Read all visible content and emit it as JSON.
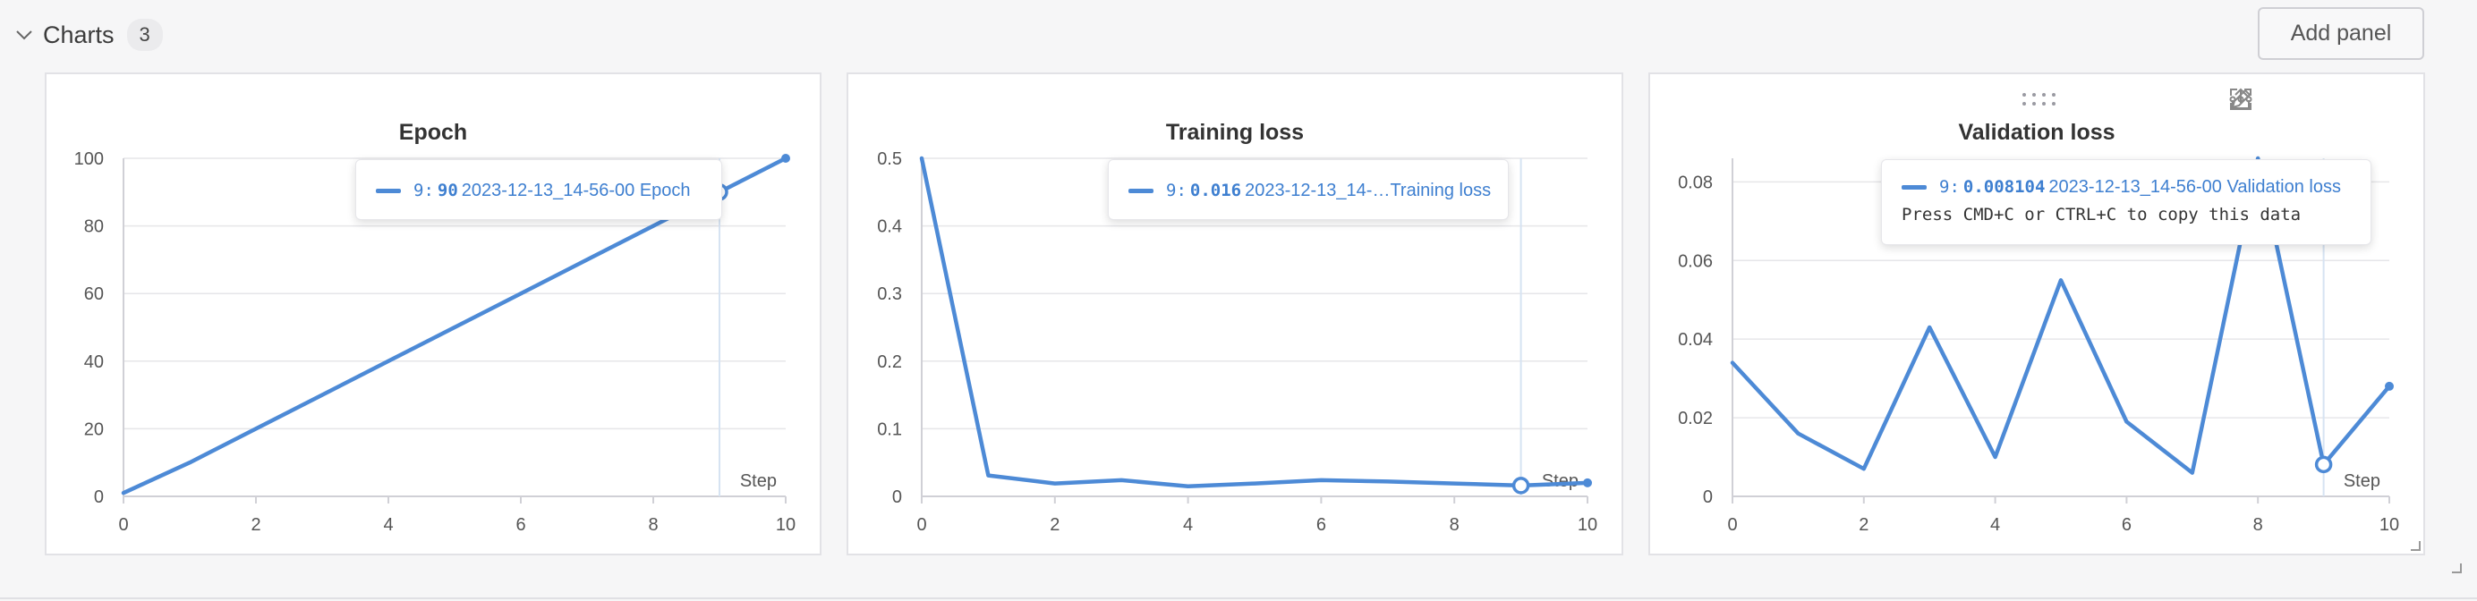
{
  "section": {
    "title": "Charts",
    "count": "3"
  },
  "toolbar": {
    "add_panel_label": "Add panel"
  },
  "colors": {
    "series": "#4d8ad6",
    "grid": "#e6e6e9",
    "axis": "#d0d0d6",
    "text": "#555555",
    "title": "#333333",
    "crosshair": "#d6e3f2"
  },
  "icons": [
    "chevron-down-icon",
    "drag-handle-icon",
    "share-icon",
    "edit-icon",
    "fullscreen-icon",
    "more-icon",
    "resize-icon"
  ],
  "tooltip_copy_hint": "Press CMD+C or CTRL+C to copy this data",
  "chart_data": [
    {
      "type": "line",
      "title": "Epoch",
      "xlabel": "Step",
      "ylabel": "",
      "xlim": [
        0,
        10
      ],
      "ylim": [
        0,
        100
      ],
      "xticks": [
        0,
        2,
        4,
        6,
        8,
        10
      ],
      "yticks": [
        0,
        20,
        40,
        60,
        80,
        100
      ],
      "ytick_labels": [
        "0",
        "20",
        "40",
        "60",
        "80",
        "100"
      ],
      "grid": true,
      "series": [
        {
          "name": "2023-12-13_14-56-00 Epoch",
          "x": [
            0,
            1,
            2,
            3,
            4,
            5,
            6,
            7,
            8,
            9,
            10
          ],
          "y": [
            1,
            10,
            20,
            30,
            40,
            50,
            60,
            70,
            80,
            90,
            100
          ]
        }
      ],
      "hover": {
        "step": 9,
        "value_label": "90",
        "series_label": "2023-12-13_14-56-00 Epoch"
      }
    },
    {
      "type": "line",
      "title": "Training loss",
      "xlabel": "Step",
      "ylabel": "",
      "xlim": [
        0,
        10
      ],
      "ylim": [
        0,
        0.5
      ],
      "xticks": [
        0,
        2,
        4,
        6,
        8,
        10
      ],
      "yticks": [
        0,
        0.1,
        0.2,
        0.3,
        0.4,
        0.5
      ],
      "ytick_labels": [
        "0",
        "0.1",
        "0.2",
        "0.3",
        "0.4",
        "0.5"
      ],
      "grid": true,
      "series": [
        {
          "name": "2023-12-13_14-…Training loss",
          "x": [
            0,
            1,
            2,
            3,
            4,
            5,
            6,
            7,
            8,
            9,
            10
          ],
          "y": [
            0.5,
            0.031,
            0.019,
            0.024,
            0.015,
            0.019,
            0.024,
            0.022,
            0.019,
            0.016,
            0.02
          ]
        }
      ],
      "hover": {
        "step": 9,
        "value_label": "0.016",
        "series_label": "2023-12-13_14-…Training loss"
      }
    },
    {
      "type": "line",
      "title": "Validation loss",
      "xlabel": "Step",
      "ylabel": "",
      "xlim": [
        0,
        10
      ],
      "ylim": [
        0,
        0.086
      ],
      "xticks": [
        0,
        2,
        4,
        6,
        8,
        10
      ],
      "yticks": [
        0,
        0.02,
        0.04,
        0.06,
        0.08
      ],
      "ytick_labels": [
        "0",
        "0.02",
        "0.04",
        "0.06",
        "0.08"
      ],
      "grid": true,
      "series": [
        {
          "name": "2023-12-13_14-56-00 Validation loss",
          "x": [
            0,
            1,
            2,
            3,
            4,
            5,
            6,
            7,
            8,
            9,
            10
          ],
          "y": [
            0.034,
            0.016,
            0.007,
            0.043,
            0.01,
            0.055,
            0.019,
            0.006,
            0.086,
            0.008104,
            0.028
          ]
        }
      ],
      "hover": {
        "step": 9,
        "value_label": "0.008104",
        "series_label": "2023-12-13_14-56-00 Validation loss"
      }
    }
  ]
}
